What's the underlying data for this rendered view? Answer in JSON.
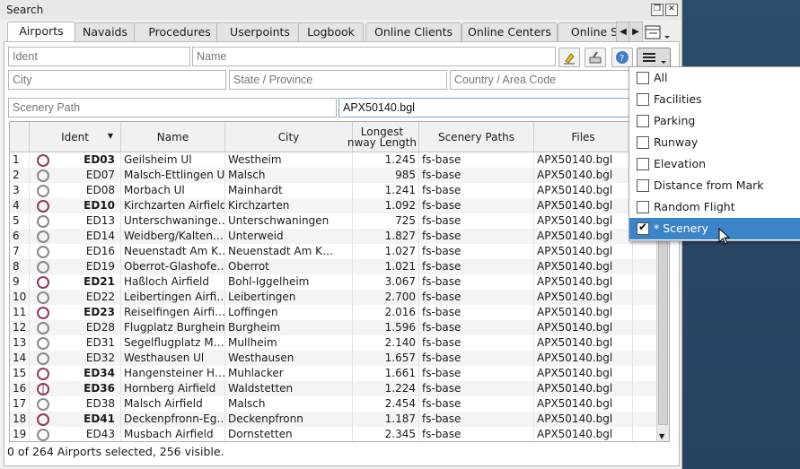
{
  "window": {
    "title": "Search"
  },
  "tabs": [
    "Airports",
    "Navaids",
    "Procedures",
    "Userpoints",
    "Logbook",
    "Online Clients",
    "Online Centers",
    "Online S"
  ],
  "filters": {
    "ident_placeholder": "Ident",
    "name_placeholder": "Name",
    "city_placeholder": "City",
    "state_placeholder": "State / Province",
    "country_placeholder": "Country / Area Code",
    "scenery_path_placeholder": "Scenery Path",
    "file_value": "APX50140.bgl"
  },
  "table": {
    "headers": {
      "ident": "Ident",
      "name": "Name",
      "city": "City",
      "longest": "Longest\nnway Length",
      "scenery": "Scenery Paths",
      "files": "Files"
    },
    "rows": [
      {
        "n": "1",
        "ident": "ED03",
        "bold": true,
        "icon": "red",
        "name": "Geilsheim Ul",
        "city": "Westheim",
        "len": "1.245",
        "sc": "fs-base",
        "file": "APX50140.bgl"
      },
      {
        "n": "2",
        "ident": "ED07",
        "bold": false,
        "icon": "gray",
        "name": "Malsch-Ettlingen Ul",
        "city": "Malsch",
        "len": "985",
        "sc": "fs-base",
        "file": "APX50140.bgl"
      },
      {
        "n": "3",
        "ident": "ED08",
        "bold": false,
        "icon": "gray",
        "name": "Morbach Ul",
        "city": "Mainhardt",
        "len": "1.241",
        "sc": "fs-base",
        "file": "APX50140.bgl"
      },
      {
        "n": "4",
        "ident": "ED10",
        "bold": true,
        "icon": "red",
        "name": "Kirchzarten Airfield",
        "city": "Kirchzarten",
        "len": "1.092",
        "sc": "fs-base",
        "file": "APX50140.bgl"
      },
      {
        "n": "5",
        "ident": "ED13",
        "bold": false,
        "icon": "gray",
        "name": "Unterschwaninge…",
        "city": "Unterschwaningen",
        "len": "725",
        "sc": "fs-base",
        "file": "APX50140.bgl"
      },
      {
        "n": "6",
        "ident": "ED14",
        "bold": false,
        "icon": "gray",
        "name": "Weidberg/Kalten…",
        "city": "Unterweid",
        "len": "1.827",
        "sc": "fs-base",
        "file": "APX50140.bgl"
      },
      {
        "n": "7",
        "ident": "ED16",
        "bold": false,
        "icon": "gray",
        "name": "Neuenstadt Am K…",
        "city": "Neuenstadt Am K…",
        "len": "1.027",
        "sc": "fs-base",
        "file": "APX50140.bgl"
      },
      {
        "n": "8",
        "ident": "ED19",
        "bold": false,
        "icon": "gray",
        "name": "Oberrot-Glashofe…",
        "city": "Oberrot",
        "len": "1.021",
        "sc": "fs-base",
        "file": "APX50140.bgl"
      },
      {
        "n": "9",
        "ident": "ED21",
        "bold": true,
        "icon": "red",
        "name": "Haßloch Airfield",
        "city": "Bohl-Iggelheim",
        "len": "3.067",
        "sc": "fs-base",
        "file": "APX50140.bgl"
      },
      {
        "n": "10",
        "ident": "ED22",
        "bold": false,
        "icon": "gray",
        "name": "Leibertingen Airfi…",
        "city": "Leibertingen",
        "len": "2.700",
        "sc": "fs-base",
        "file": "APX50140.bgl"
      },
      {
        "n": "11",
        "ident": "ED23",
        "bold": true,
        "icon": "red",
        "name": "Reiselfingen Airfi…",
        "city": "Loffingen",
        "len": "2.016",
        "sc": "fs-base",
        "file": "APX50140.bgl"
      },
      {
        "n": "12",
        "ident": "ED28",
        "bold": false,
        "icon": "gray",
        "name": "Flugplatz Burgheim",
        "city": "Burgheim",
        "len": "1.596",
        "sc": "fs-base",
        "file": "APX50140.bgl"
      },
      {
        "n": "13",
        "ident": "ED31",
        "bold": false,
        "icon": "gray",
        "name": "Segelflugplatz M…",
        "city": "Mullheim",
        "len": "2.140",
        "sc": "fs-base",
        "file": "APX50140.bgl"
      },
      {
        "n": "14",
        "ident": "ED32",
        "bold": false,
        "icon": "gray",
        "name": "Westhausen Ul",
        "city": "Westhausen",
        "len": "1.657",
        "sc": "fs-base",
        "file": "APX50140.bgl"
      },
      {
        "n": "15",
        "ident": "ED34",
        "bold": true,
        "icon": "red",
        "name": "Hangensteiner H…",
        "city": "Muhlacker",
        "len": "1.661",
        "sc": "fs-base",
        "file": "APX50140.bgl"
      },
      {
        "n": "16",
        "ident": "ED36",
        "bold": true,
        "icon": "half",
        "name": "Hornberg Airfield",
        "city": "Waldstetten",
        "len": "1.224",
        "sc": "fs-base",
        "file": "APX50140.bgl"
      },
      {
        "n": "17",
        "ident": "ED38",
        "bold": false,
        "icon": "gray",
        "name": "Malsch Airfield",
        "city": "Malsch",
        "len": "2.454",
        "sc": "fs-base",
        "file": "APX50140.bgl"
      },
      {
        "n": "18",
        "ident": "ED41",
        "bold": true,
        "icon": "red",
        "name": "Deckenpfronn-Eg…",
        "city": "Deckenpfronn",
        "len": "1.187",
        "sc": "fs-base",
        "file": "APX50140.bgl"
      },
      {
        "n": "19",
        "ident": "ED43",
        "bold": false,
        "icon": "gray",
        "name": "Musbach Airfield",
        "city": "Dornstetten",
        "len": "2.345",
        "sc": "fs-base",
        "file": "APX50140.bgl"
      }
    ]
  },
  "status": "0 of 264 Airports selected, 256 visible.",
  "menu": [
    {
      "label": "All",
      "checked": false,
      "hl": false
    },
    {
      "label": "Facilities",
      "checked": false,
      "hl": false
    },
    {
      "label": "Parking",
      "checked": false,
      "hl": false
    },
    {
      "label": "Runway",
      "checked": false,
      "hl": false
    },
    {
      "label": "Elevation",
      "checked": false,
      "hl": false
    },
    {
      "label": "Distance from Mark",
      "checked": false,
      "hl": false
    },
    {
      "label": "Random Flight",
      "checked": false,
      "hl": false
    },
    {
      "label": "* Scenery",
      "checked": true,
      "hl": true
    }
  ],
  "icons": [
    "restore-icon",
    "close-icon",
    "chevron-left-icon",
    "chevron-right-icon",
    "tab-list-icon",
    "clear-filter-icon",
    "reset-icon",
    "help-icon",
    "menu-icon",
    "sort-arrow-icon",
    "mouse-cursor-icon"
  ]
}
